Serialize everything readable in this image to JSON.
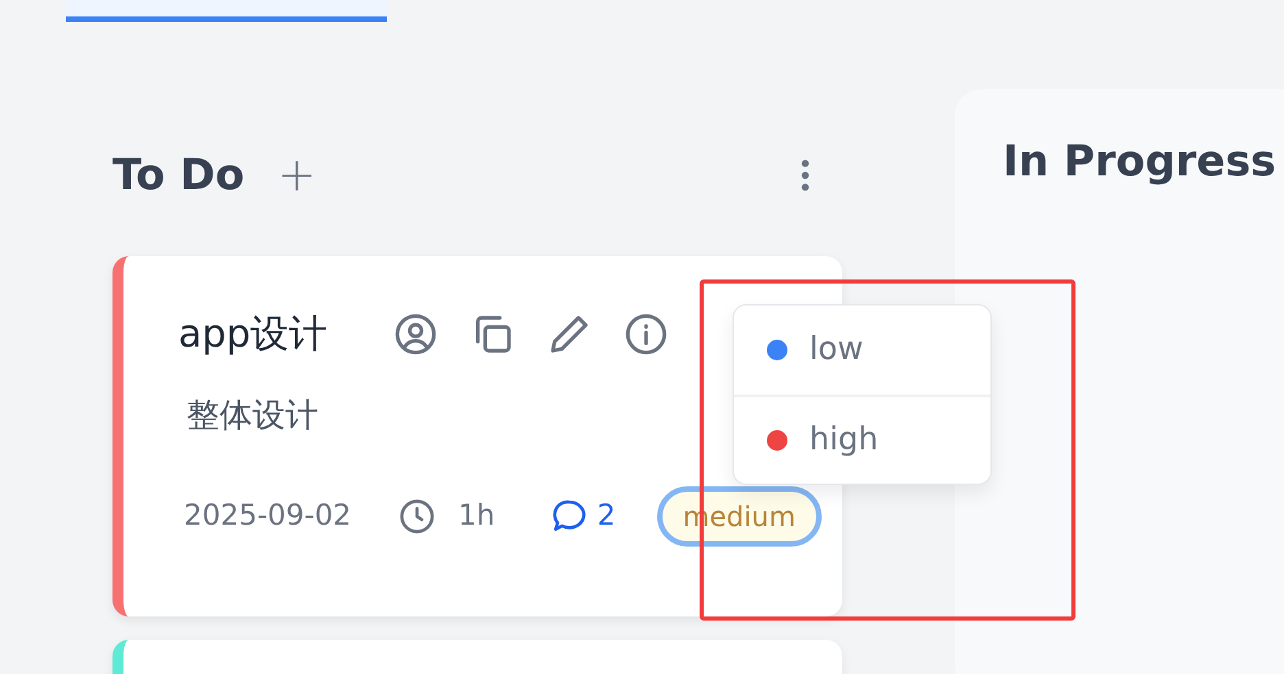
{
  "columns": [
    {
      "title": "To Do",
      "add_label": "+",
      "cards": [
        {
          "title": "app设计",
          "description": "整体设计",
          "date": "2025-09-02",
          "duration": "1h",
          "comments": "2",
          "priority": "medium",
          "color": "#f87171"
        },
        {
          "color": "#5eead4"
        }
      ]
    },
    {
      "title": "In Progress"
    }
  ],
  "priority_menu": {
    "options": [
      {
        "label": "low",
        "color": "#3b82f6"
      },
      {
        "label": "high",
        "color": "#ef4444"
      }
    ]
  },
  "annotation": {
    "kind": "highlight-box"
  }
}
